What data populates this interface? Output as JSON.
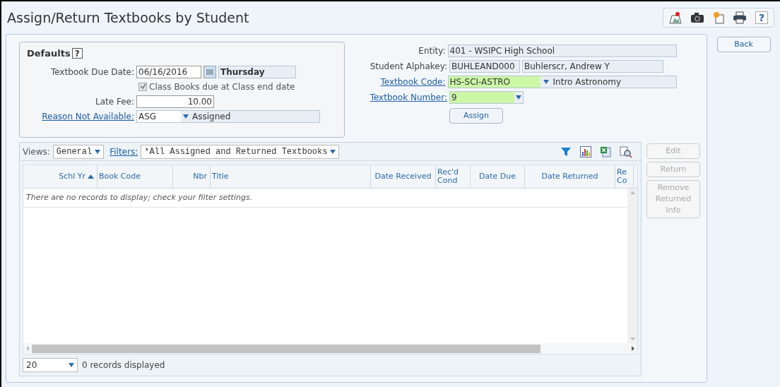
{
  "title": "Assign/Return Textbooks by Student",
  "help_button": "?",
  "defaults": {
    "heading": "Defaults",
    "help": "?",
    "due_date_label": "Textbook Due Date:",
    "due_date": "06/16/2016",
    "due_day": "Thursday",
    "class_books": {
      "label": "Class Books due at Class end date",
      "checked": true,
      "disabled": true
    },
    "late_fee_label": "Late Fee:",
    "late_fee": "10.00",
    "reason_label": "Reason Not Available:",
    "reason_code": "ASG",
    "reason_desc": "Assigned"
  },
  "student": {
    "entity_label": "Entity:",
    "entity": "401 - WSIPC High School",
    "alphakey_label": "Student Alphakey:",
    "alphakey": "BUHLEAND000",
    "student_name": "Buhlerscr, Andrew Y",
    "code_label": "Textbook Code:",
    "code": "HS-SCI-ASTRO",
    "code_desc": "Intro Astronomy",
    "number_label": "Textbook Number:",
    "number": "9",
    "assign_button": "Assign"
  },
  "back_button": "Back",
  "grid": {
    "views_label": "Views:",
    "view": "General",
    "filters_label": "Filters:",
    "filter": "*All Assigned and Returned Textbooks",
    "columns": [
      {
        "label": "Schl Yr",
        "sorted": true
      },
      {
        "label": "Book Code",
        "sorted": false
      },
      {
        "label": "Nbr",
        "sorted": false
      },
      {
        "label": "Title",
        "sorted": false
      },
      {
        "label": "Date Received",
        "sorted": false
      },
      {
        "label": "Rec'd Cond",
        "sorted": false
      },
      {
        "label": "Date Due",
        "sorted": false
      },
      {
        "label": "Date Returned",
        "sorted": false
      },
      {
        "label": "Re Co",
        "sorted": false
      }
    ],
    "empty_message": "There are no records to display; check your filter settings.",
    "page_size": "20",
    "record_count": "0 records displayed"
  },
  "actions": [
    {
      "label": "Edit",
      "disabled": true
    },
    {
      "label": "Return",
      "disabled": true
    },
    {
      "label": "Remove Returned Info",
      "disabled": true
    }
  ]
}
